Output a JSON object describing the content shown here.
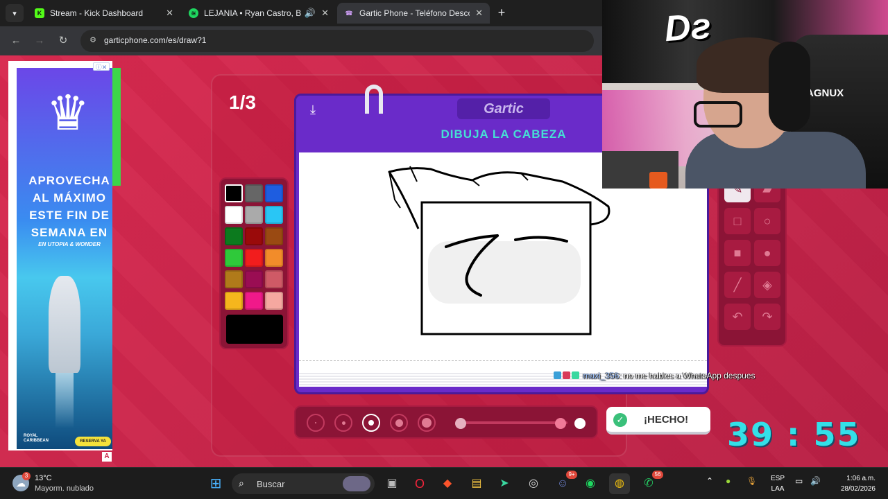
{
  "browser": {
    "tabs": [
      {
        "title": "Stream - Kick Dashboard",
        "favicon": "kick-logo-icon",
        "color": "#53fc18"
      },
      {
        "title": "LEJANIA • Ryan Castro, Bles",
        "favicon": "spotify-icon",
        "color": "#1ed760"
      },
      {
        "title": "Gartic Phone - Teléfono Descor",
        "favicon": "gartic-phone-icon",
        "color": "#b16ef0"
      }
    ],
    "active_tab_index": 2,
    "url": "garticphone.com/es/draw?1"
  },
  "ad": {
    "headline": "APROVECHA AL MÁXIMO ESTE FIN DE SEMANA EN",
    "subline": "EN UTOPIA & WONDER",
    "brand": "ROYAL CARIBBEAN",
    "cta": "RESERVA YA",
    "corner": "A"
  },
  "game": {
    "round": "1/3",
    "logo": "Gartic",
    "prompt": "DIBUJA LA CABEZA",
    "palette": [
      "#000000",
      "#666666",
      "#1e5de0",
      "#ffffff",
      "#aaaaaa",
      "#29c6f5",
      "#0c7a1e",
      "#9a0a0a",
      "#9a4a12",
      "#2fc93a",
      "#f21d1d",
      "#f28c2a",
      "#b07a1a",
      "#9a0d53",
      "#cf5a66",
      "#f5b61d",
      "#f0198a",
      "#f5a8a0"
    ],
    "selected_color": "#000000",
    "tools": [
      "pencil-icon",
      "eraser-icon",
      "rectangle-outline-icon",
      "circle-outline-icon",
      "rectangle-filled-icon",
      "circle-filled-icon",
      "line-icon",
      "fill-bucket-icon",
      "undo-icon",
      "redo-icon"
    ],
    "selected_tool": 0,
    "brush_sizes": 5,
    "selected_size": 2,
    "opacity": 1.0,
    "done_label": "¡HECHO!"
  },
  "chat": {
    "user": "maxi_356",
    "message": ": no me hables a WhatsApp despues"
  },
  "stream": {
    "timer": "39 : 55",
    "chair_text": "AGNUX"
  },
  "taskbar": {
    "weather_badge": "3",
    "temp": "13°C",
    "condition": "Mayorm. nublado",
    "search_placeholder": "Buscar",
    "discord_badge": "9+",
    "whatsapp_badge": "56",
    "lang1": "ESP",
    "lang2": "LAA",
    "time": "1:06 a.m.",
    "date": "28/02/2026"
  }
}
